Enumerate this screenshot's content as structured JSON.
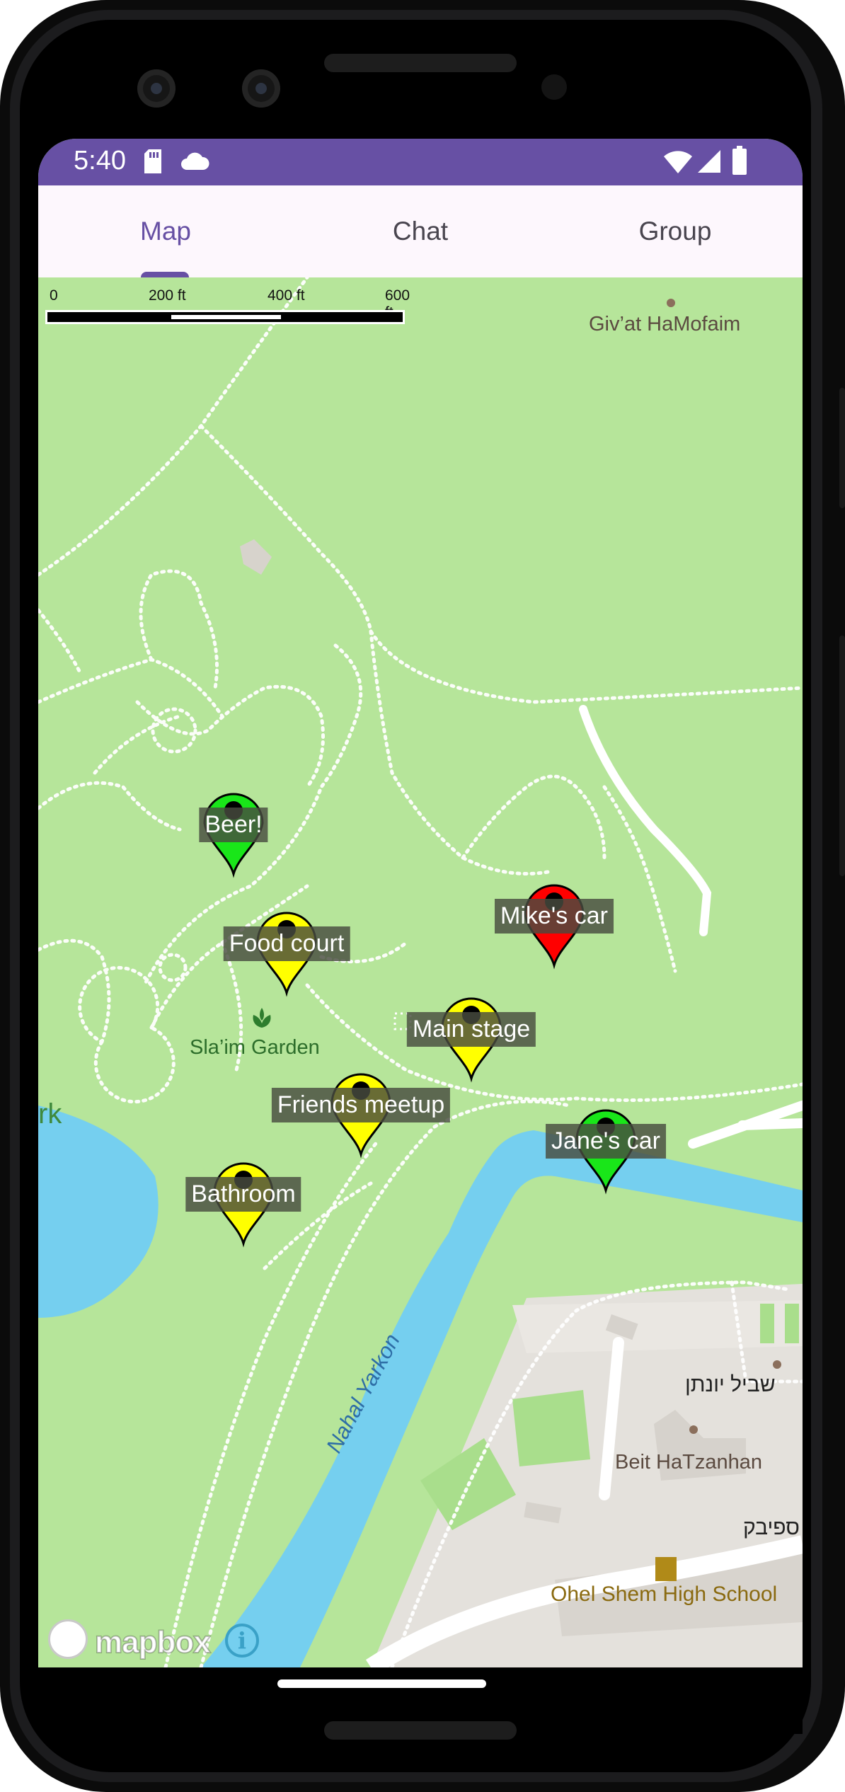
{
  "status_bar": {
    "time": "5:40",
    "icons": [
      "sd-card-icon",
      "cloud-icon",
      "wifi-icon",
      "signal-icon",
      "battery-icon"
    ],
    "color": "#6750a4"
  },
  "tabs": [
    {
      "label": "Map",
      "active": true
    },
    {
      "label": "Chat",
      "active": false
    },
    {
      "label": "Group",
      "active": false
    }
  ],
  "map": {
    "scale_labels": [
      "0",
      "200 ft",
      "400 ft",
      "600 ft"
    ],
    "places": {
      "givat": "Giv’at HaMofaim",
      "garden": "Sla’im Garden",
      "park_fragment": "rk",
      "river": "Nahal Yarkon",
      "hebrew_street": "שביל יונתן",
      "hebrew_place": "ספיבק",
      "beit": "Beit HaTzanhan",
      "school": "Ohel Shem High School"
    },
    "markers": [
      {
        "label": "Beer!",
        "color": "#19e619"
      },
      {
        "label": "Food court",
        "color": "#ffff00"
      },
      {
        "label": "Mike's car",
        "color": "#ff0000"
      },
      {
        "label": "Main stage",
        "color": "#ffff00"
      },
      {
        "label": "Friends meetup",
        "color": "#ffff00"
      },
      {
        "label": "Jane's car",
        "color": "#19e619"
      },
      {
        "label": "Bathroom",
        "color": "#ffff00"
      }
    ],
    "attribution": {
      "logo": "mapbox",
      "info": "i"
    }
  }
}
